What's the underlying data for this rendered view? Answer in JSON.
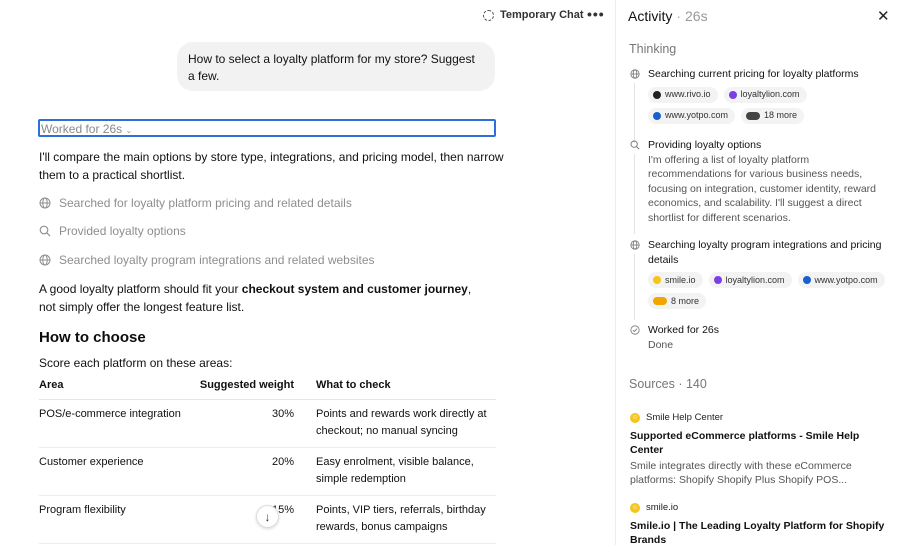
{
  "topbar": {
    "temp_chat_label": "Temporary Chat",
    "more_label": "•••"
  },
  "chat": {
    "user_message": "How to select a loyalty platform for my store? Suggest a few.",
    "worked_label": "Worked for 26s",
    "intro": "I'll compare the main options by store type, integrations, and pricing model, then narrow them to a practical shortlist.",
    "steps": [
      {
        "icon": "globe-icon",
        "label": "Searched for loyalty platform pricing and related details"
      },
      {
        "icon": "search-icon",
        "label": "Provided loyalty options"
      },
      {
        "icon": "globe-icon",
        "label": "Searched loyalty program integrations and related websites"
      }
    ],
    "fit_para_prefix": "A good loyalty platform should fit your ",
    "fit_para_bold": "checkout system and customer journey",
    "fit_para_suffix": ", not simply offer the longest feature list.",
    "heading": "How to choose",
    "score_text": "Score each platform on these areas:",
    "table": {
      "headers": [
        "Area",
        "Suggested weight",
        "What to check"
      ],
      "rows": [
        [
          "POS/e-commerce integration",
          "30%",
          "Points and rewards work directly at checkout; no manual syncing"
        ],
        [
          "Customer experience",
          "20%",
          "Easy enrolment, visible balance, simple redemption"
        ],
        [
          "Program flexibility",
          "15%",
          "Points, VIP tiers, referrals, birthday rewards, bonus campaigns"
        ]
      ]
    },
    "scroll_down_icon": "↓"
  },
  "panel": {
    "title": "Activity",
    "separator": "·",
    "duration": "26s",
    "close_icon": "✕",
    "thinking_label": "Thinking",
    "items": [
      {
        "icon": "globe-icon",
        "title": "Searching current pricing for loyalty platforms",
        "chips": [
          {
            "label": "www.rivo.io",
            "color": "#222222"
          },
          {
            "label": "loyaltylion.com",
            "color": "#7b3fe4"
          },
          {
            "label": "www.yotpo.com",
            "color": "#1a5fd0"
          },
          {
            "label": "18 more",
            "color": "#444444"
          }
        ]
      },
      {
        "icon": "search-icon",
        "title": "Providing loyalty options",
        "desc": "I'm offering a list of loyalty platform recommendations for various business needs, focusing on integration, customer identity, reward economics, and scalability. I'll suggest a direct shortlist for different scenarios."
      },
      {
        "icon": "globe-icon",
        "title": "Searching loyalty program integrations and pricing details",
        "chips": [
          {
            "label": "smile.io",
            "color": "#f5c518"
          },
          {
            "label": "loyaltylion.com",
            "color": "#7b3fe4"
          },
          {
            "label": "www.yotpo.com",
            "color": "#1a5fd0"
          },
          {
            "label": "8 more",
            "color": "#f0a500"
          }
        ]
      },
      {
        "icon": "check-circle-icon",
        "title": "Worked for 26s",
        "desc": "Done"
      }
    ],
    "sources_label": "Sources",
    "sources_count": "140",
    "sources": [
      {
        "site": "Smile Help Center",
        "title": "Supported eCommerce platforms - Smile Help Center",
        "snippet": "Smile integrates directly with these eCommerce platforms: Shopify Shopify Plus Shopify POS..."
      },
      {
        "site": "smile.io",
        "title": "Smile.io | The Leading Loyalty Platform for Shopify Brands",
        "snippet": ""
      }
    ]
  }
}
